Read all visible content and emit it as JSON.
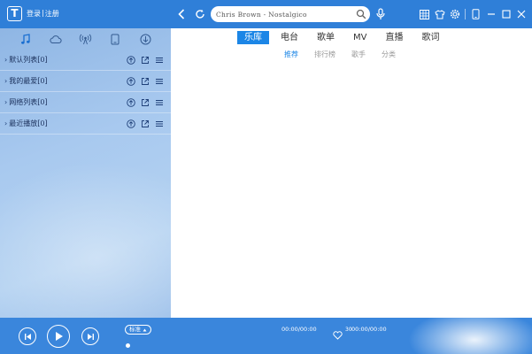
{
  "app": {
    "logo_letter": "T",
    "login_text": "登录",
    "login_sep": "|",
    "register_text": "注册"
  },
  "search": {
    "value": "Chris Brown - Nostalgico"
  },
  "sidebar": {
    "tabs": [
      "music-note-icon",
      "cloud-icon",
      "radio-icon",
      "device-icon",
      "download-icon"
    ],
    "playlists": [
      {
        "label": "默认列表[0]"
      },
      {
        "label": "我的最爱[0]"
      },
      {
        "label": "网络列表[0]"
      },
      {
        "label": "最近播放[0]"
      }
    ]
  },
  "main": {
    "tabs": [
      {
        "label": "乐库",
        "active": true
      },
      {
        "label": "电台",
        "active": false
      },
      {
        "label": "歌单",
        "active": false
      },
      {
        "label": "MV",
        "active": false
      },
      {
        "label": "直播",
        "active": false
      },
      {
        "label": "歌词",
        "active": false
      }
    ],
    "subtabs": [
      {
        "label": "推荐",
        "active": true
      },
      {
        "label": "排行榜",
        "active": false
      },
      {
        "label": "歌手",
        "active": false
      },
      {
        "label": "分类",
        "active": false
      }
    ]
  },
  "player": {
    "quality_label": "标准",
    "time_current": "00:00/00:00",
    "volume": "30",
    "time_total": "00:00/00:00",
    "progress": 0
  },
  "colors": {
    "topbar": "#2f7fd8",
    "accent": "#1c86e6",
    "player": "#3a86dc"
  }
}
